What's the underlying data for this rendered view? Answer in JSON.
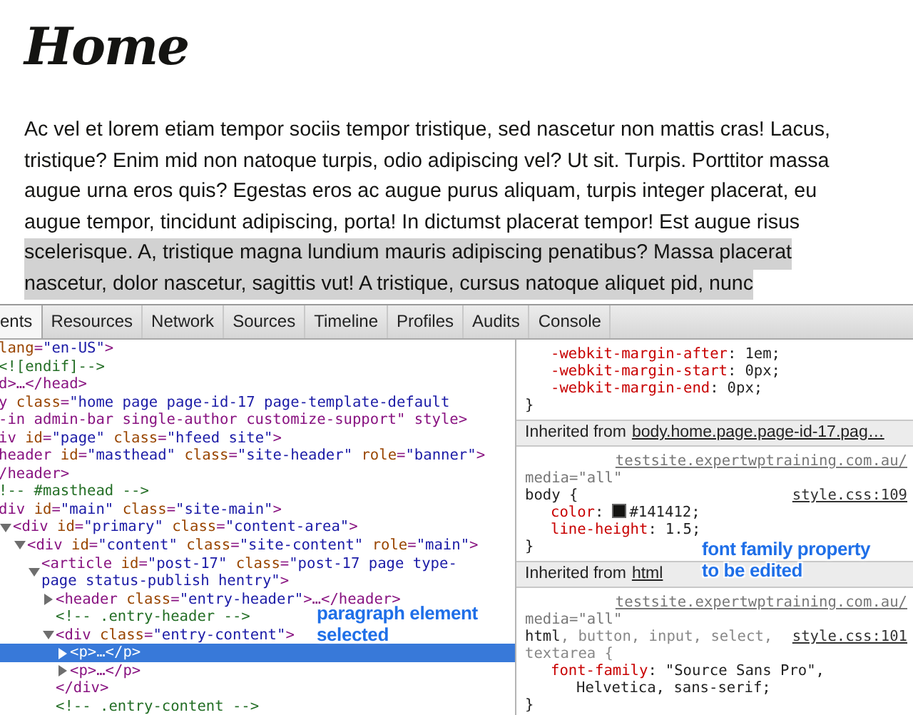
{
  "page": {
    "heading": "Home",
    "paragraph_lines": [
      {
        "text": "Ac vel et lorem etiam tempor sociis tempor tristique, sed nascetur non mattis cras! Lacus,",
        "highlighted": false
      },
      {
        "text": "tristique? Enim mid non natoque turpis, odio adipiscing vel? Ut sit. Turpis. Porttitor massa",
        "highlighted": false
      },
      {
        "text": "augue urna eros quis? Egestas eros ac augue purus aliquam, turpis integer placerat, eu",
        "highlighted": false
      },
      {
        "text": "augue tempor, tincidunt adipiscing, porta! In dictumst placerat tempor! Est augue risus",
        "highlighted": false
      },
      {
        "text": "scelerisque. A, tristique magna lundium mauris adipiscing penatibus? Massa placerat",
        "highlighted": true
      },
      {
        "text": "nascetur, dolor nascetur, sagittis vut! A tristique, cursus natoque aliquet pid, nunc",
        "highlighted": true
      }
    ]
  },
  "devtools": {
    "tabs": [
      {
        "label": "ents",
        "selected": true
      },
      {
        "label": "Resources",
        "selected": false
      },
      {
        "label": "Network",
        "selected": false
      },
      {
        "label": "Sources",
        "selected": false
      },
      {
        "label": "Timeline",
        "selected": false
      },
      {
        "label": "Profiles",
        "selected": false
      },
      {
        "label": "Audits",
        "selected": false
      },
      {
        "label": "Console",
        "selected": false
      }
    ],
    "dom_tree": [
      {
        "text": "lang=\"en-US\">",
        "kind": "tag",
        "selected": false
      },
      {
        "text": "<![endif]-->",
        "kind": "comment",
        "selected": false
      },
      {
        "text": "d>…</head>",
        "kind": "tag",
        "selected": false
      },
      {
        "text": "y class=\"home page page-id-17 page-template-default",
        "kind": "tag",
        "selected": false
      },
      {
        "text": "-in admin-bar single-author customize-support\" style>",
        "kind": "tag",
        "selected": false
      },
      {
        "text": "iv id=\"page\" class=\"hfeed site\">",
        "kind": "tag",
        "selected": false
      },
      {
        "text": "header id=\"masthead\" class=\"site-header\" role=\"banner\">",
        "kind": "tag",
        "selected": false
      },
      {
        "text": "/header>",
        "kind": "tag",
        "selected": false
      },
      {
        "text": "!-- #masthead -->",
        "kind": "comment",
        "selected": false
      },
      {
        "text": "div id=\"main\" class=\"site-main\">",
        "kind": "tag",
        "selected": false,
        "children": [
          {
            "text": "<div id=\"primary\" class=\"content-area\">",
            "kind": "tag",
            "selected": false,
            "expanded": true,
            "children": [
              {
                "text": "<div id=\"content\" class=\"site-content\" role=\"main\">",
                "kind": "tag",
                "selected": false,
                "expanded": true,
                "children": [
                  {
                    "text": "<article id=\"post-17\" class=\"post-17 page type-page status-publish hentry\">",
                    "kind": "tag",
                    "selected": false,
                    "expanded": true,
                    "children": [
                      {
                        "text": "<header class=\"entry-header\">…</header>",
                        "kind": "tag",
                        "selected": false,
                        "expanded": false
                      },
                      {
                        "text": "<!-- .entry-header -->",
                        "kind": "comment",
                        "selected": false
                      },
                      {
                        "text": "<div class=\"entry-content\">",
                        "kind": "tag",
                        "selected": false,
                        "expanded": true,
                        "children": [
                          {
                            "text": "<p>…</p>",
                            "kind": "tag",
                            "selected": true,
                            "expanded": false
                          },
                          {
                            "text": "<p>…</p>",
                            "kind": "tag",
                            "selected": false,
                            "expanded": false
                          }
                        ]
                      },
                      {
                        "text": "</div>",
                        "kind": "tag",
                        "selected": false
                      },
                      {
                        "text": "<!-- .entry-content -->",
                        "kind": "comment",
                        "selected": false
                      }
                    ]
                  }
                ]
              }
            ]
          }
        ]
      }
    ],
    "styles": {
      "rule_tail": {
        "declarations": [
          {
            "property": "-webkit-margin-after",
            "separator": ":",
            "value_lines": [
              "1em;"
            ]
          },
          {
            "property": "-webkit-margin-start",
            "separator": ":",
            "value_lines": [
              "0px;"
            ]
          },
          {
            "property": "-webkit-margin-end",
            "separator": ":",
            "value_lines": [
              "0px;"
            ]
          }
        ],
        "close": "}"
      },
      "sections": [
        {
          "label": "Inherited from",
          "link": "body.home.page.page-id-17.pag…",
          "rules": [
            {
              "source": "testsite.expertwptraining.com.au/",
              "media": "media=\"all\"",
              "location": "style.css:109",
              "selector_lines": [
                [
                  {
                    "text": "body {",
                    "matched": true
                  }
                ]
              ],
              "declarations": [
                {
                  "property": "color",
                  "separator": ":",
                  "value_lines": [
                    "#141412;"
                  ],
                  "color": "#141412"
                },
                {
                  "property": "line-height",
                  "separator": ":",
                  "value_lines": [
                    "1.5;"
                  ]
                }
              ],
              "close": "}"
            }
          ]
        },
        {
          "label": "Inherited from",
          "link": "html",
          "rules": [
            {
              "source": "testsite.expertwptraining.com.au/",
              "media": "media=\"all\"",
              "location": "style.css:101",
              "selector_lines": [
                [
                  {
                    "text": "html",
                    "matched": true
                  },
                  {
                    "text": ", button, input, select,",
                    "matched": false
                  }
                ],
                [
                  {
                    "text": "textarea {",
                    "matched": false
                  }
                ]
              ],
              "declarations": [
                {
                  "property": "font-family",
                  "separator": ":",
                  "value_lines": [
                    "\"Source Sans Pro\",",
                    "Helvetica, sans-serif;"
                  ]
                }
              ],
              "close": "}"
            }
          ]
        }
      ]
    }
  },
  "annotations": [
    {
      "text": "paragraph element selected"
    },
    {
      "text": "font family property to be edited"
    }
  ]
}
